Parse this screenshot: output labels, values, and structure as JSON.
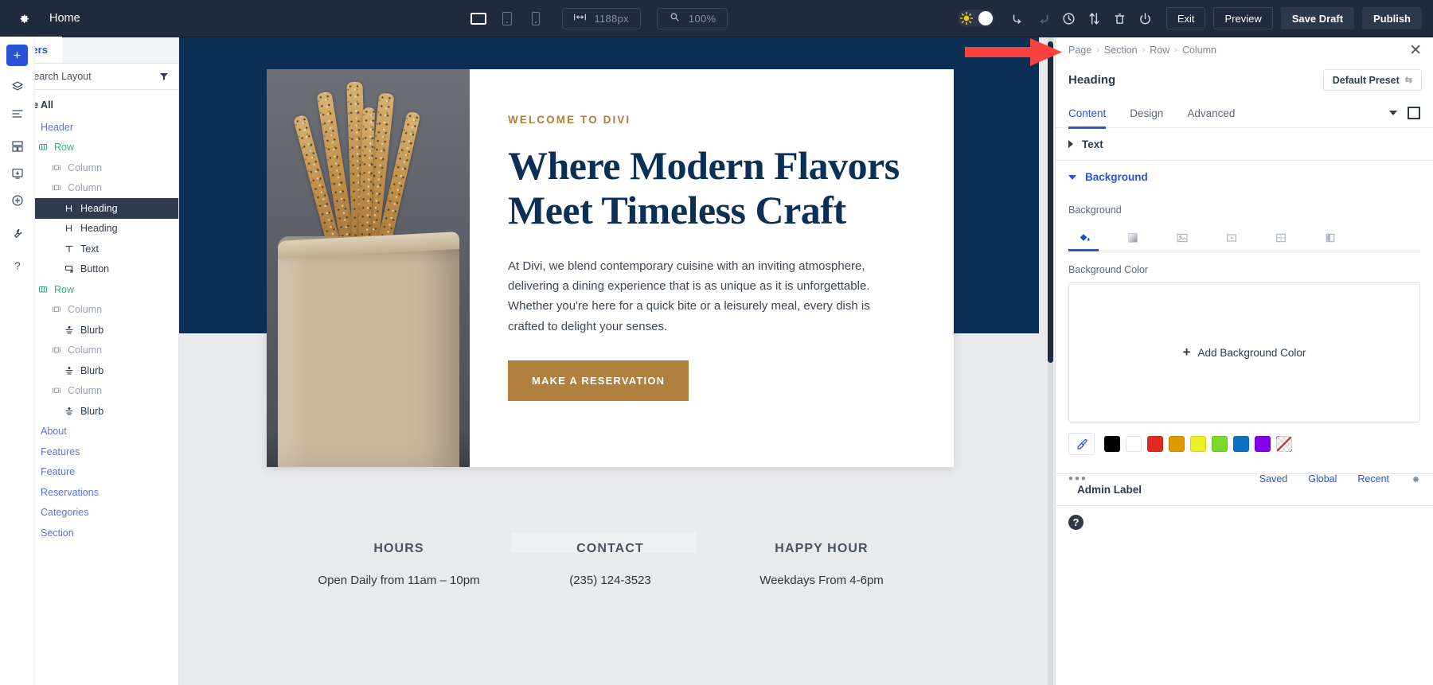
{
  "topbar": {
    "gear_icon": "gear-icon",
    "page_title": "Home",
    "devices": [
      {
        "name": "desktop-view",
        "icon": "desktop-icon",
        "active": true
      },
      {
        "name": "tablet-view",
        "icon": "tablet-icon",
        "active": false
      },
      {
        "name": "phone-view",
        "icon": "phone-icon",
        "active": false
      }
    ],
    "width_value": "1188px",
    "width_icon": "width-arrows-icon",
    "zoom_value": "100%",
    "zoom_icon": "magnifier-icon",
    "theme_toggle_icon": "sun-icon",
    "icons": [
      {
        "name": "undo-icon"
      },
      {
        "name": "redo-icon"
      },
      {
        "name": "history-clock-icon"
      },
      {
        "name": "sort-updown-icon"
      },
      {
        "name": "trash-icon"
      },
      {
        "name": "power-icon"
      }
    ],
    "exit_label": "Exit",
    "preview_label": "Preview",
    "save_draft_label": "Save Draft",
    "publish_label": "Publish"
  },
  "layers_panel": {
    "tab_label": "Layers",
    "search_placeholder": "Search Layout",
    "search_icon": "search-icon",
    "filter_icon": "filter-icon",
    "close_all_label": "Close All",
    "items": [
      {
        "label": "Header",
        "type": "section",
        "icon": "section-icon",
        "selected": false
      },
      {
        "label": "Row",
        "type": "row",
        "icon": "row-icon",
        "selected": false
      },
      {
        "label": "Column",
        "type": "column",
        "icon": "column-icon",
        "selected": false
      },
      {
        "label": "Column",
        "type": "column",
        "icon": "column-icon",
        "selected": false
      },
      {
        "label": "Heading",
        "type": "module",
        "icon": "heading-icon",
        "selected": true
      },
      {
        "label": "Heading",
        "type": "module",
        "icon": "heading-icon",
        "selected": false
      },
      {
        "label": "Text",
        "type": "module",
        "icon": "text-icon",
        "selected": false
      },
      {
        "label": "Button",
        "type": "module",
        "icon": "button-icon",
        "selected": false
      },
      {
        "label": "Row",
        "type": "row",
        "icon": "row-icon",
        "selected": false
      },
      {
        "label": "Column",
        "type": "column",
        "icon": "column-icon",
        "selected": false
      },
      {
        "label": "Blurb",
        "type": "module",
        "icon": "blurb-icon",
        "selected": false
      },
      {
        "label": "Column",
        "type": "column",
        "icon": "column-icon",
        "selected": false
      },
      {
        "label": "Blurb",
        "type": "module",
        "icon": "blurb-icon",
        "selected": false
      },
      {
        "label": "Column",
        "type": "column",
        "icon": "column-icon",
        "selected": false
      },
      {
        "label": "Blurb",
        "type": "module",
        "icon": "blurb-icon",
        "selected": false
      },
      {
        "label": "About",
        "type": "section",
        "icon": "section-icon",
        "selected": false
      },
      {
        "label": "Features",
        "type": "section",
        "icon": "section-icon",
        "selected": false
      },
      {
        "label": "Feature",
        "type": "section",
        "icon": "section-icon",
        "selected": false
      },
      {
        "label": "Reservations",
        "type": "section",
        "icon": "section-icon",
        "selected": false
      },
      {
        "label": "Categories",
        "type": "section",
        "icon": "section-icon",
        "selected": false
      },
      {
        "label": "Section",
        "type": "section",
        "icon": "section-icon",
        "selected": false
      }
    ]
  },
  "rail": {
    "add_label": "+",
    "icons": [
      {
        "name": "layers-stack-icon"
      },
      {
        "name": "list-lines-icon"
      },
      {
        "name": "wireframe-icon"
      },
      {
        "name": "portability-icon"
      },
      {
        "name": "save-library-icon"
      },
      {
        "name": "tools-icon"
      },
      {
        "name": "help-question-icon"
      }
    ]
  },
  "canvas": {
    "hero": {
      "eyebrow": "WELCOME TO DIVI",
      "heading_line1": "Where Modern Flavors",
      "heading_line2": "Meet Timeless Craft",
      "paragraph": "At Divi, we blend contemporary cuisine with an inviting atmosphere, delivering a dining experience that is as unique as it is unforgettable. Whether you're here for a quick bite or a leisurely meal, every dish is crafted to delight your senses.",
      "button_label": "MAKE A RESERVATION",
      "image_alt": "seeded-breadsticks-in-paper-bag"
    },
    "info_columns": [
      {
        "title": "HOURS",
        "value": "Open Daily from 11am – 10pm"
      },
      {
        "title": "CONTACT",
        "value": "(235) 124-3523"
      },
      {
        "title": "HAPPY HOUR",
        "value": "Weekdays From 4-6pm"
      }
    ]
  },
  "settings_panel": {
    "breadcrumb": [
      "Page",
      "Section",
      "Row",
      "Column"
    ],
    "breadcrumb_separator": "›",
    "close_icon": "close-icon",
    "module_title": "Heading",
    "preset_label": "Default Preset",
    "preset_icon": "preset-swap-icon",
    "tabs": [
      {
        "label": "Content",
        "active": true
      },
      {
        "label": "Design",
        "active": false
      },
      {
        "label": "Advanced",
        "active": false
      }
    ],
    "tabs_right_icons": [
      {
        "name": "chevron-down-icon"
      },
      {
        "name": "expand-square-icon"
      }
    ],
    "accordions": [
      {
        "label": "Text",
        "open": false
      },
      {
        "label": "Background",
        "open": true
      }
    ],
    "background": {
      "section_label": "Background",
      "types": [
        {
          "name": "background-color-type",
          "icon": "paint-bucket-icon",
          "active": true
        },
        {
          "name": "background-gradient-type",
          "icon": "gradient-icon",
          "active": false
        },
        {
          "name": "background-image-type",
          "icon": "image-icon",
          "active": false
        },
        {
          "name": "background-video-type",
          "icon": "video-icon",
          "active": false
        },
        {
          "name": "background-pattern-type",
          "icon": "pattern-icon",
          "active": false
        },
        {
          "name": "background-mask-type",
          "icon": "mask-icon",
          "active": false
        }
      ],
      "color_label": "Background Color",
      "add_color_label": "Add Background Color",
      "add_color_plus": "+",
      "eyedropper_icon": "eyedropper-icon",
      "swatches": [
        "#000000",
        "#ffffff",
        "#e02b20",
        "#e09900",
        "#edef25",
        "#7cdb2a",
        "#0c71c3",
        "#8300e9",
        "transparent"
      ],
      "more_dots": "•••",
      "links": [
        "Saved",
        "Global",
        "Recent"
      ],
      "settings_gear_icon": "gear-small-icon"
    },
    "admin_label": "Admin Label",
    "help_label": "?"
  },
  "annotation": {
    "arrow_name": "red-pointer-arrow",
    "arrow_color": "#f8423f"
  }
}
